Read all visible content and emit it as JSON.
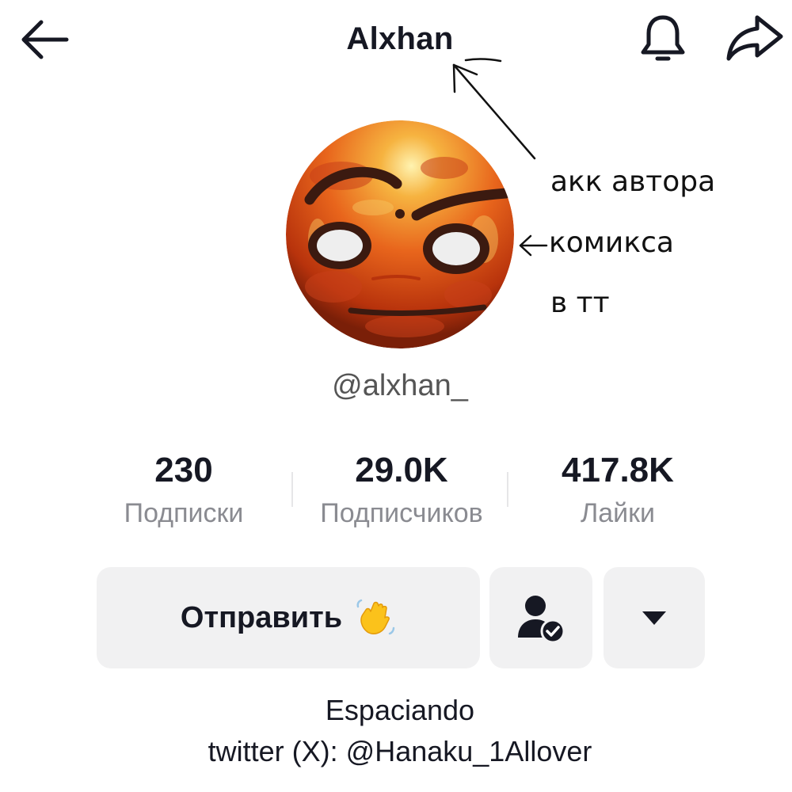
{
  "header": {
    "title": "Alxhan"
  },
  "annotation": {
    "lines": [
      "акк автора",
      "комикса",
      "в тт"
    ]
  },
  "profile": {
    "handle": "@alxhan_"
  },
  "stats": [
    {
      "value": "230",
      "label": "Подписки"
    },
    {
      "value": "29.0K",
      "label": "Подписчиков"
    },
    {
      "value": "417.8K",
      "label": "Лайки"
    }
  ],
  "actions": {
    "message_label": "Отправить"
  },
  "bio": {
    "line1": "Espaciando",
    "line2": "twitter (X): @Hanaku_1Allover"
  },
  "icons": {
    "back": "arrow-left-icon",
    "bell": "bell-icon",
    "share": "share-arrow-icon",
    "wave": "waving-hand-icon",
    "follow": "user-check-icon",
    "more": "caret-down-icon"
  },
  "colors": {
    "text": "#161823",
    "secondary": "#8a8b91",
    "button_bg": "#f1f1f2",
    "avatar_orange": "#e8651c"
  }
}
